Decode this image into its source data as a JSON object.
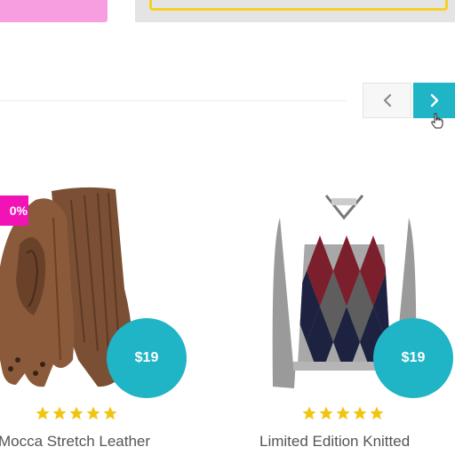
{
  "colors": {
    "accent": "#1fb4c6",
    "sale_badge": "#f213b7",
    "star": "#f1c40f",
    "banner_pink": "#f79ee1",
    "banner_border_yellow": "#f6d125"
  },
  "carousel": {
    "prev_icon": "chevron-left-icon",
    "next_icon": "chevron-right-icon"
  },
  "products": [
    {
      "name": "Mocca Stretch Leather",
      "price": "$19",
      "badge": "0%",
      "rating": 5,
      "image": "brown-leather-gloves"
    },
    {
      "name": "Limited Edition Knitted",
      "price": "$19",
      "rating": 5,
      "image": "argyle-sweater"
    }
  ]
}
